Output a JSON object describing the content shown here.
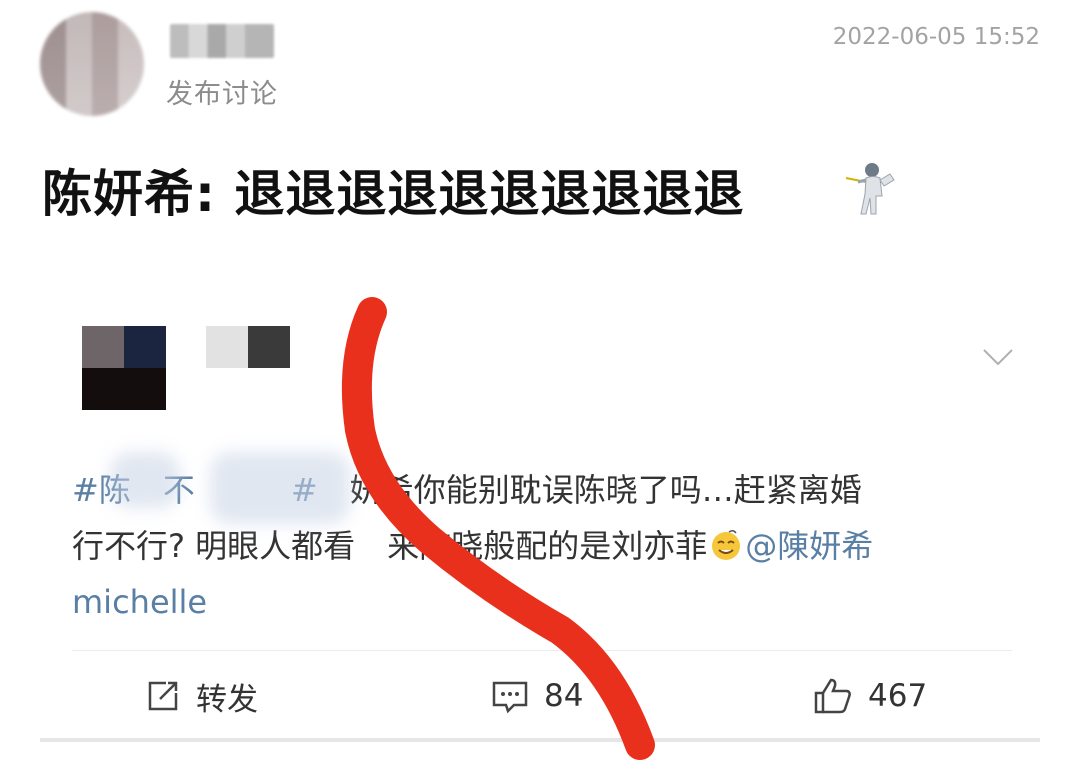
{
  "header": {
    "subtitle": "发布讨论",
    "timestamp": "2022-06-05 15:52"
  },
  "headline": {
    "text": "陈妍希: 退退退退退退退退退退",
    "emoji_icon": "fencer-icon"
  },
  "embedded_post": {
    "text_line1_hashtag_a": "#陈",
    "text_line1_gap": "不",
    "text_line1_hashtag_b": "#",
    "text_line1_body": "妍希你能别耽误陈晓了吗…赶紧离婚",
    "text_line2": "行不行? 明眼人都看",
    "text_line2_cont": "来陈晓般配的是刘亦菲",
    "emoji": "dizzy-face-icon",
    "mention_a": "@陳妍希",
    "mention_b": "michelle"
  },
  "actions": {
    "repost_label": "转发",
    "comment_count": "84",
    "like_count": "467"
  },
  "colors": {
    "link": "#5a7fa5",
    "annotation_red": "#e8301c"
  }
}
